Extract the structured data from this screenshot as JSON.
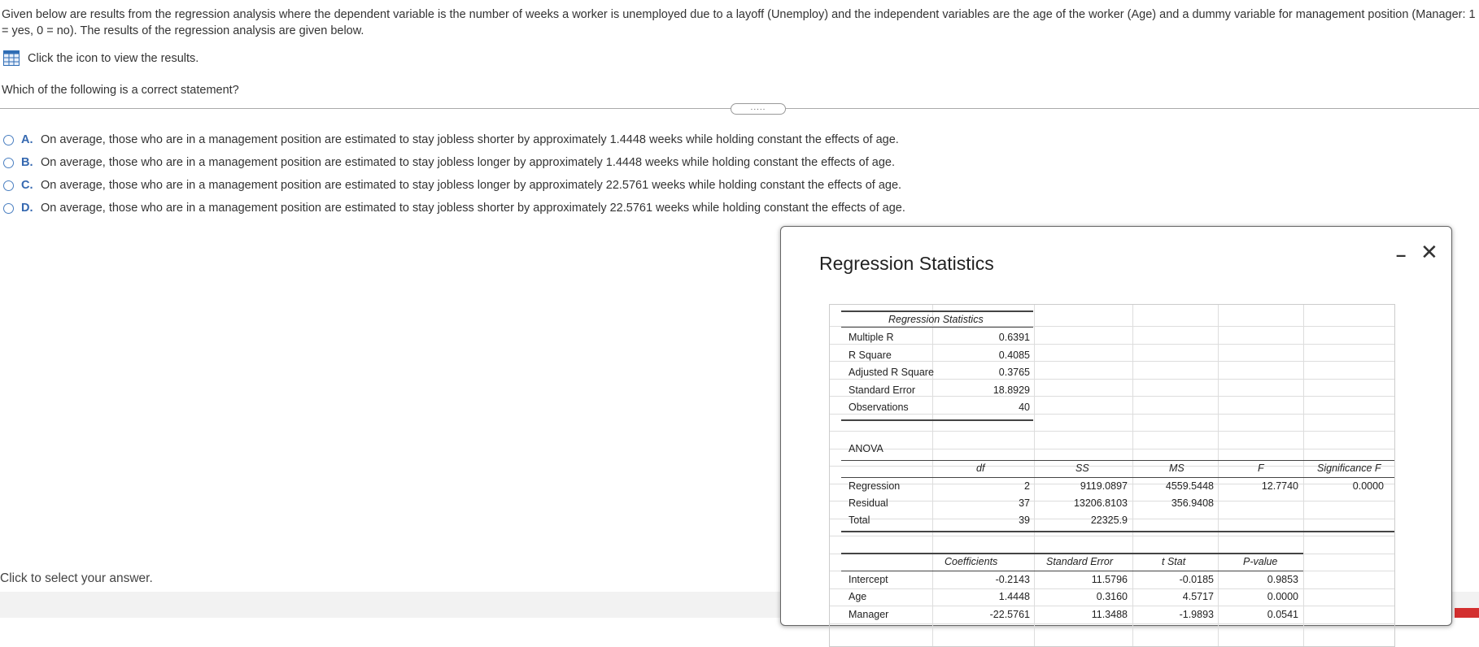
{
  "intro_text": "Given below are results from the regression analysis where the dependent variable is the number of weeks a worker is unemployed due to a layoff (Unemploy) and the independent variables are the age of the worker (Age) and a dummy variable for management position (Manager: 1 = yes, 0 = no). The results of the regression analysis are given below.",
  "view_results_label": "Click the icon to view the results.",
  "question": "Which of the following is a correct statement?",
  "handle_label": ".....",
  "options": [
    {
      "letter": "A.",
      "text": "On average, those who are in a management position are estimated to stay jobless shorter by approximately 1.4448 weeks while holding constant the effects of age."
    },
    {
      "letter": "B.",
      "text": "On average, those who are in a management position are estimated to stay jobless longer by approximately 1.4448 weeks while holding constant the effects of age."
    },
    {
      "letter": "C.",
      "text": "On average, those who are in a management position are estimated to stay jobless longer by approximately 22.5761 weeks while holding constant the effects of age."
    },
    {
      "letter": "D.",
      "text": "On average, those who are in a management position are estimated to stay jobless shorter by approximately 22.5761 weeks while holding constant the effects of age."
    }
  ],
  "select_prompt": "Click to select your answer.",
  "dialog": {
    "title": "Regression Statistics",
    "minimize_glyph": "–",
    "close_glyph": "✕",
    "stats_header": "Regression Statistics",
    "stats": [
      {
        "label": "Multiple R",
        "value": "0.6391"
      },
      {
        "label": "R Square",
        "value": "0.4085"
      },
      {
        "label": "Adjusted R Square",
        "value": "0.3765"
      },
      {
        "label": "Standard Error",
        "value": "18.8929"
      },
      {
        "label": "Observations",
        "value": "40"
      }
    ],
    "anova_label": "ANOVA",
    "anova_headers": [
      "df",
      "SS",
      "MS",
      "F",
      "Significance F"
    ],
    "anova_rows": [
      {
        "label": "Regression",
        "df": "2",
        "ss": "9119.0897",
        "ms": "4559.5448",
        "f": "12.7740",
        "sig": "0.0000"
      },
      {
        "label": "Residual",
        "df": "37",
        "ss": "13206.8103",
        "ms": "356.9408",
        "f": "",
        "sig": ""
      },
      {
        "label": "Total",
        "df": "39",
        "ss": "22325.9",
        "ms": "",
        "f": "",
        "sig": ""
      }
    ],
    "coef_headers": [
      "Coefficients",
      "Standard Error",
      "t Stat",
      "P-value"
    ],
    "coef_rows": [
      {
        "label": "Intercept",
        "coef": "-0.2143",
        "se": "11.5796",
        "t": "-0.0185",
        "p": "0.9853"
      },
      {
        "label": "Age",
        "coef": "1.4448",
        "se": "0.3160",
        "t": "4.5717",
        "p": "0.0000"
      },
      {
        "label": "Manager",
        "coef": "-22.5761",
        "se": "11.3488",
        "t": "-1.9893",
        "p": "0.0541"
      }
    ]
  },
  "colors": {
    "accent": "#3568b0",
    "radio": "#4a7fc1",
    "corner": "#d32f2f"
  }
}
